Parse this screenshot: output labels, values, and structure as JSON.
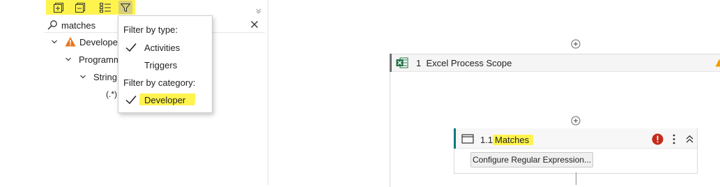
{
  "activities_panel": {
    "toolbar": {
      "buttons": [
        {
          "icon": "expand-all-icon"
        },
        {
          "icon": "collapse-all-icon"
        },
        {
          "icon": "list-view-icon"
        },
        {
          "icon": "filter-icon",
          "active": true
        }
      ],
      "highlight_color": "#fff34d"
    },
    "search": {
      "value": "matches",
      "icon": "search-icon",
      "clear_icon": "close-icon"
    },
    "tree": [
      {
        "label": "Developer",
        "icon": "warning-icon",
        "expanded": true,
        "level": 0
      },
      {
        "label": "Programm",
        "expanded": true,
        "level": 1
      },
      {
        "label": "String",
        "expanded": true,
        "level": 2
      },
      {
        "label": "(.*)",
        "level": 3
      }
    ]
  },
  "filter_popup": {
    "type_heading": "Filter by type:",
    "type_options": [
      {
        "label": "Activities",
        "checked": true
      },
      {
        "label": "Triggers",
        "checked": false
      }
    ],
    "category_heading": "Filter by category:",
    "category_options": [
      {
        "label": "Developer",
        "checked": true,
        "highlighted": true
      }
    ]
  },
  "designer": {
    "scope": {
      "index": "1",
      "title": "Excel Process Scope",
      "icon": "excel-icon",
      "has_warning": true
    },
    "matches_activity": {
      "index": "1.1",
      "title": "Matches",
      "icon": "activity-window-icon",
      "has_error": true,
      "config_button": "Configure Regular Expression..."
    },
    "colors": {
      "highlight": "#fff34d",
      "error": "#c42b1c",
      "warning": "#f29d00",
      "excel_green": "#1f7244",
      "matches_accent": "#007a7a"
    }
  }
}
